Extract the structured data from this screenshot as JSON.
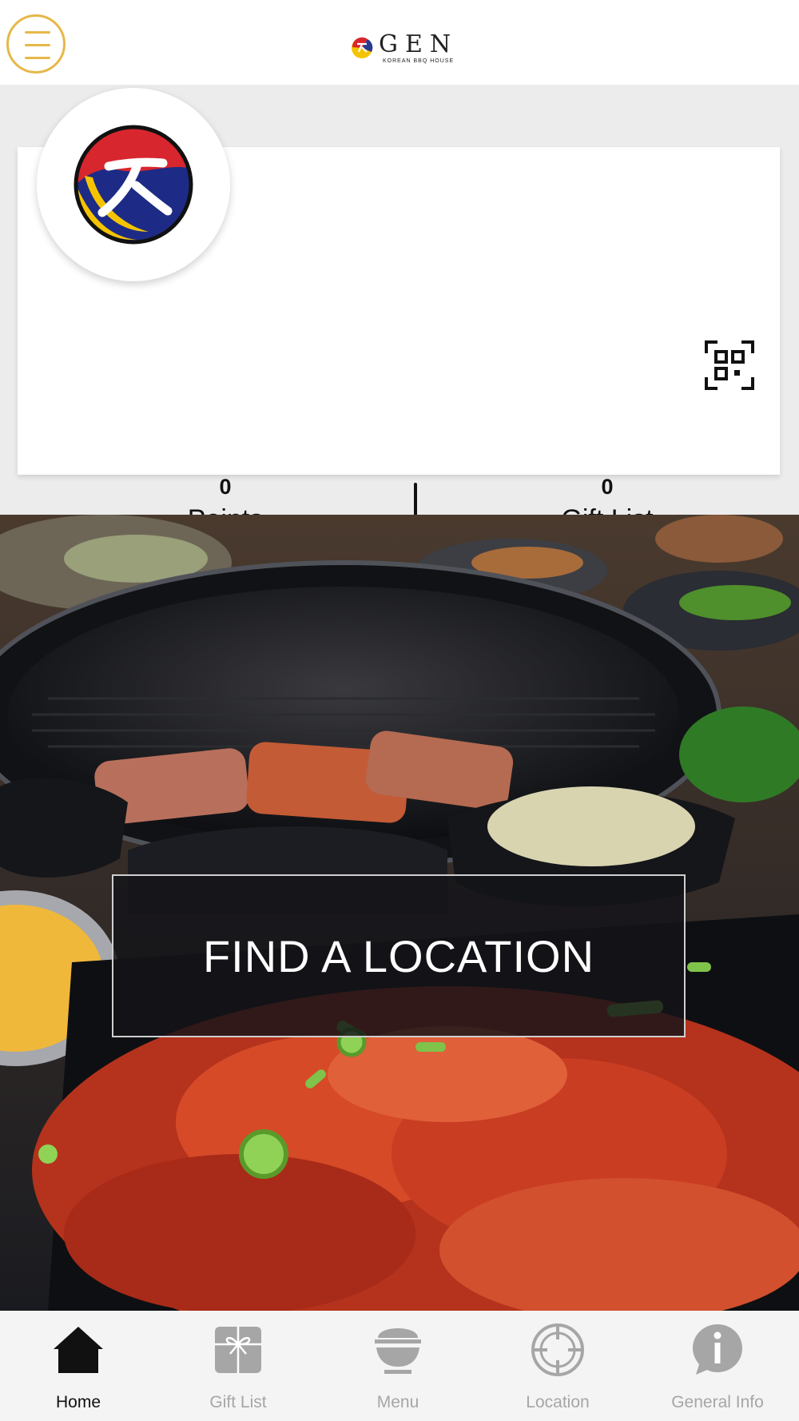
{
  "header": {
    "logo": {
      "brand": "GEN",
      "tagline": "KOREAN BBQ HOUSE"
    },
    "menu_icon": "hamburger-menu-icon"
  },
  "rewards": {
    "points": {
      "count": "0",
      "label": "Points",
      "icon": "badge-check-icon"
    },
    "gift_list": {
      "count": "0",
      "label": "Gift List",
      "icon": "gift-icon"
    },
    "qr_icon": "qr-code-icon",
    "avatar_icon": "brand-emblem-icon"
  },
  "hero": {
    "button_label": "FIND A LOCATION"
  },
  "tabbar": {
    "items": [
      {
        "label": "Home",
        "icon": "home-icon",
        "active": true
      },
      {
        "label": "Gift List",
        "icon": "gift-icon",
        "active": false
      },
      {
        "label": "Menu",
        "icon": "bowl-icon",
        "active": false
      },
      {
        "label": "Location",
        "icon": "crosshair-icon",
        "active": false
      },
      {
        "label": "General Info",
        "icon": "info-icon",
        "active": false
      }
    ]
  },
  "colors": {
    "accent": "#e6b84a",
    "tab_active": "#111111",
    "tab_inactive": "#a6a6a6",
    "band": "#ececec"
  }
}
